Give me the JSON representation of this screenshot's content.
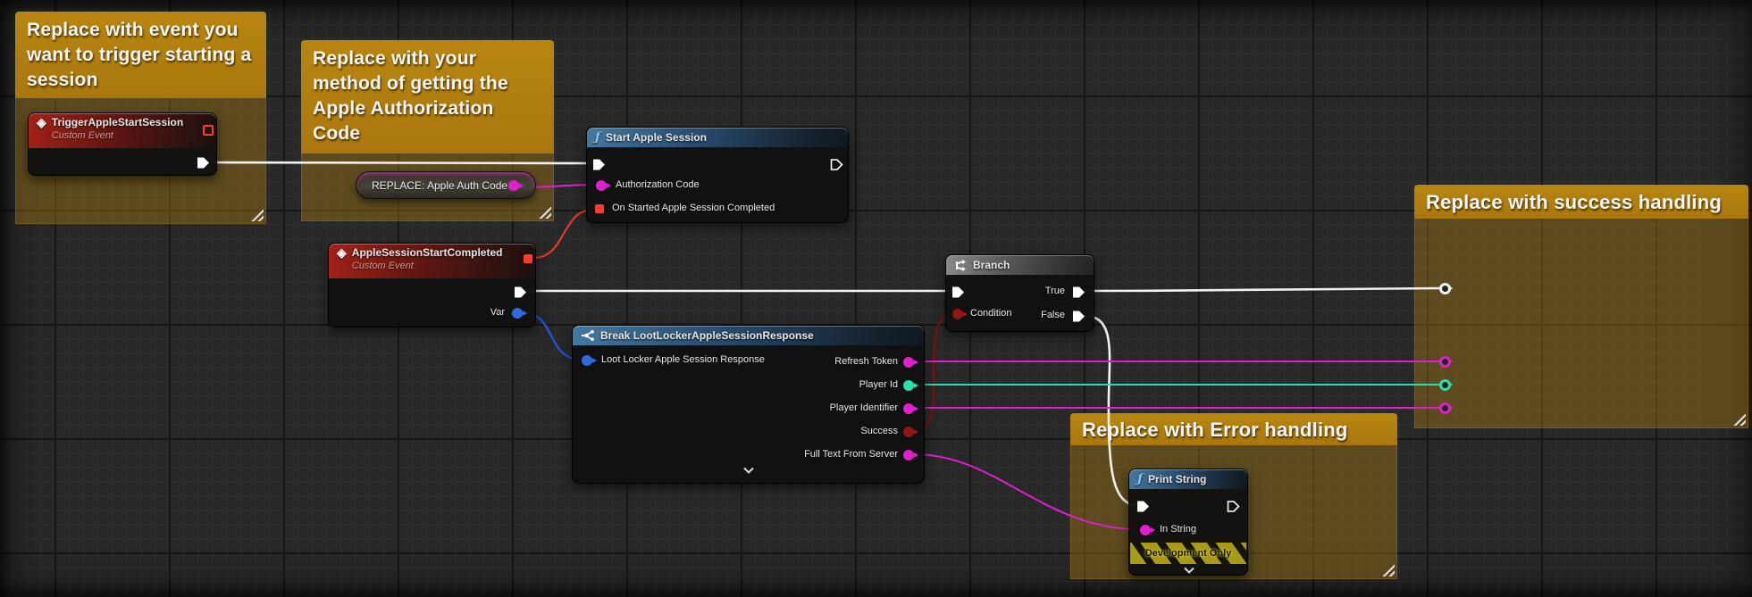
{
  "graph": {
    "comments": {
      "trigger": "Replace with event you want to trigger starting a session",
      "auth_code": "Replace with your method of getting the Apple Authorization Code",
      "success": "Replace with success handling",
      "error": "Replace with Error handling"
    },
    "nodes": {
      "trigger_event": {
        "title": "TriggerAppleStartSession",
        "subtitle": "Custom Event"
      },
      "replace_pill": {
        "label": "REPLACE: Apple Auth Code"
      },
      "start_session": {
        "title": "Start Apple Session",
        "pin_auth": "Authorization Code",
        "pin_on_completed": "On Started Apple Session Completed"
      },
      "session_completed": {
        "title": "AppleSessionStartCompleted",
        "subtitle": "Custom Event",
        "pin_var": "Var"
      },
      "break_response": {
        "title": "Break LootLockerAppleSessionResponse",
        "pin_input": "Loot Locker Apple Session Response",
        "pin_refresh": "Refresh Token",
        "pin_player_id": "Player Id",
        "pin_player_identifier": "Player Identifier",
        "pin_success": "Success",
        "pin_full_text": "Full Text From Server"
      },
      "branch": {
        "title": "Branch",
        "pin_condition": "Condition",
        "pin_true": "True",
        "pin_false": "False"
      },
      "print_string": {
        "title": "Print String",
        "pin_in_string": "In String",
        "banner": "Development Only"
      }
    },
    "colors": {
      "comment_header": "#b8860f",
      "exec_pin": "#ffffff",
      "string_pin": "#e11fd0",
      "int_pin": "#27e0ac",
      "bool_pin": "#8e1616",
      "object_pin": "#2e6be0",
      "delegate_pin": "#ff3b30",
      "event_header": "#a32219",
      "function_header": "#45799f",
      "branch_header": "#8a8a8a"
    }
  }
}
